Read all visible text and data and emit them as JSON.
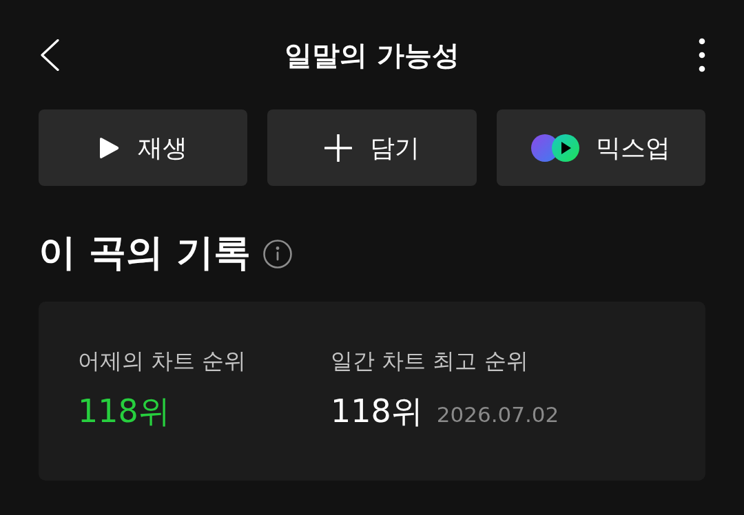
{
  "header": {
    "title": "일말의 가능성"
  },
  "actions": [
    {
      "kind": "play",
      "label": "재생"
    },
    {
      "kind": "add",
      "label": "담기"
    },
    {
      "kind": "mixup",
      "label": "믹스업"
    }
  ],
  "section": {
    "title": "이 곡의 기록"
  },
  "records": [
    {
      "label": "어제의 차트 순위",
      "value": "118위",
      "color": "#27cf3e"
    },
    {
      "label": "일간 차트 최고 순위",
      "value": "118위",
      "color": "#ffffff",
      "date": "2026.07.02"
    }
  ]
}
